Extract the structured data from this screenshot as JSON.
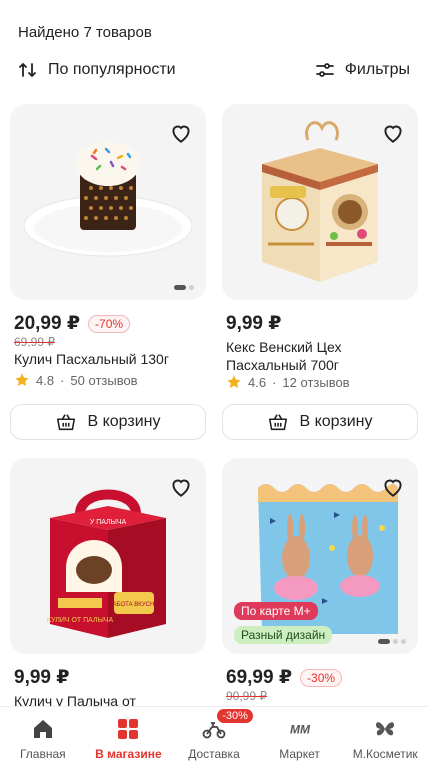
{
  "header": {
    "found_text": "Найдено 7 товаров",
    "sort_label": "По популярности",
    "sort_icon": "sort-arrows-icon",
    "filter_label": "Фильтры",
    "filter_icon": "sliders-icon"
  },
  "products": [
    {
      "price": "20,99 ₽",
      "discount": "-70%",
      "old_price": "69,99 ₽",
      "name": "Кулич Пасхальный 130г",
      "rating": "4.8",
      "reviews": "50 отзывов",
      "cart_label": "В корзину"
    },
    {
      "price": "9,99 ₽",
      "name": "Кекс Венский Цех Пасхальный 700г",
      "rating": "4.6",
      "reviews": "12 отзывов",
      "cart_label": "В корзину"
    },
    {
      "price": "9,99 ₽",
      "name": "Кулич у Палыча от",
      "image_text": [
        "У ПАЛЫЧА",
        "КУЛИЧ ОТ ПАЛЫЧА",
        "ЗАБОТА ВКУСНО"
      ]
    },
    {
      "price": "69,99 ₽",
      "discount": "-30%",
      "old_price": "90,99 ₽",
      "badge_card": "По карте М+",
      "badge_design": "Разный дизайн"
    }
  ],
  "tabbar": {
    "items": [
      {
        "label": "Главная",
        "icon": "home-icon"
      },
      {
        "label": "В магазине",
        "icon": "store-icon"
      },
      {
        "label": "Доставка",
        "icon": "courier-icon",
        "promo": "-30%"
      },
      {
        "label": "Маркет",
        "icon": "market-logo-icon",
        "logo_text": "MM"
      },
      {
        "label": "М.Косметик",
        "icon": "butterfly-icon"
      }
    ],
    "active_index": 1
  },
  "colors": {
    "accent": "#e3342f",
    "star": "#f2b21f",
    "card_bg": "#f4f4f4"
  }
}
